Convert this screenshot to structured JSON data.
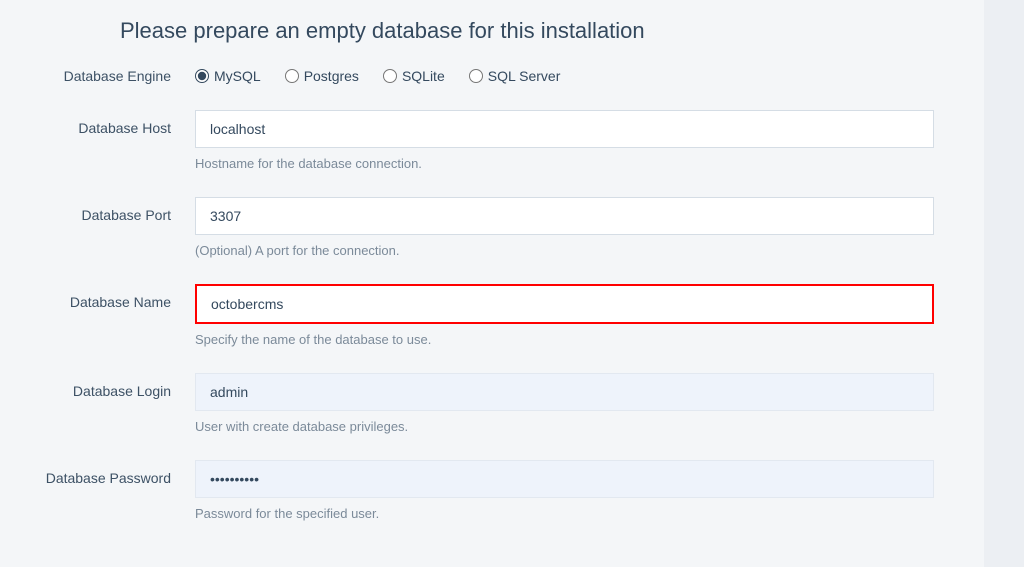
{
  "heading": "Please prepare an empty database for this installation",
  "form": {
    "engine": {
      "label": "Database Engine",
      "options": [
        {
          "label": "MySQL",
          "value": "mysql"
        },
        {
          "label": "Postgres",
          "value": "postgres"
        },
        {
          "label": "SQLite",
          "value": "sqlite"
        },
        {
          "label": "SQL Server",
          "value": "sqlserver"
        }
      ],
      "selected": "mysql"
    },
    "host": {
      "label": "Database Host",
      "value": "localhost",
      "help": "Hostname for the database connection."
    },
    "port": {
      "label": "Database Port",
      "value": "3307",
      "help": "(Optional) A port for the connection."
    },
    "name": {
      "label": "Database Name",
      "value": "octobercms",
      "help": "Specify the name of the database to use."
    },
    "login": {
      "label": "Database Login",
      "value": "admin",
      "help": "User with create database privileges."
    },
    "password": {
      "label": "Database Password",
      "value": "••••••••••",
      "help": "Password for the specified user."
    }
  }
}
